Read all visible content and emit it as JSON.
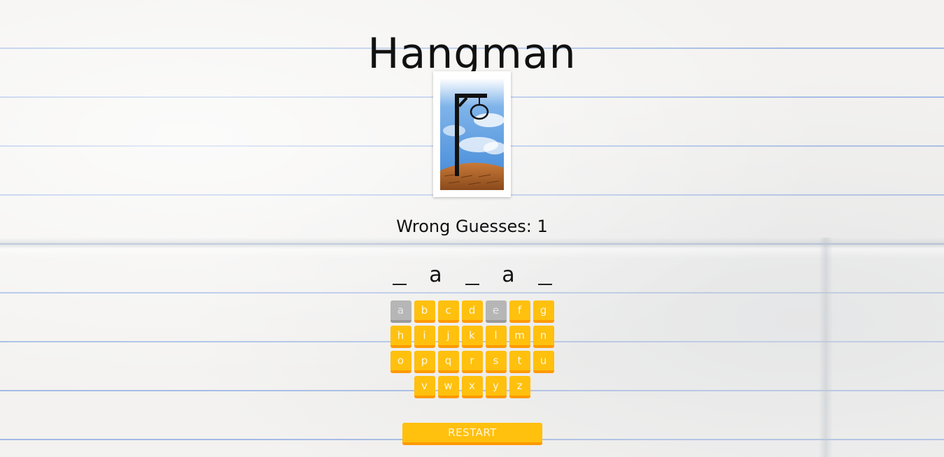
{
  "title": "Hangman",
  "status": {
    "wrong_guesses_label": "Wrong Guesses: 1",
    "wrong_guesses": 1
  },
  "word": {
    "slots": [
      "_",
      "a",
      "_",
      "a",
      "_"
    ]
  },
  "keyboard": {
    "rows": [
      [
        "a",
        "b",
        "c",
        "d",
        "e",
        "f",
        "g"
      ],
      [
        "h",
        "i",
        "j",
        "k",
        "l",
        "m",
        "n"
      ],
      [
        "o",
        "p",
        "q",
        "r",
        "s",
        "t",
        "u"
      ],
      [
        "v",
        "w",
        "x",
        "y",
        "z"
      ]
    ],
    "used": [
      "a",
      "e"
    ]
  },
  "restart_label": "RESTART",
  "colors": {
    "key": "#ffc00e",
    "key_shadow": "#ff9a00",
    "key_used": "#b6b6b6",
    "paper_lines": "#608cdc"
  },
  "icons": {
    "gallows": "gallows-image"
  }
}
